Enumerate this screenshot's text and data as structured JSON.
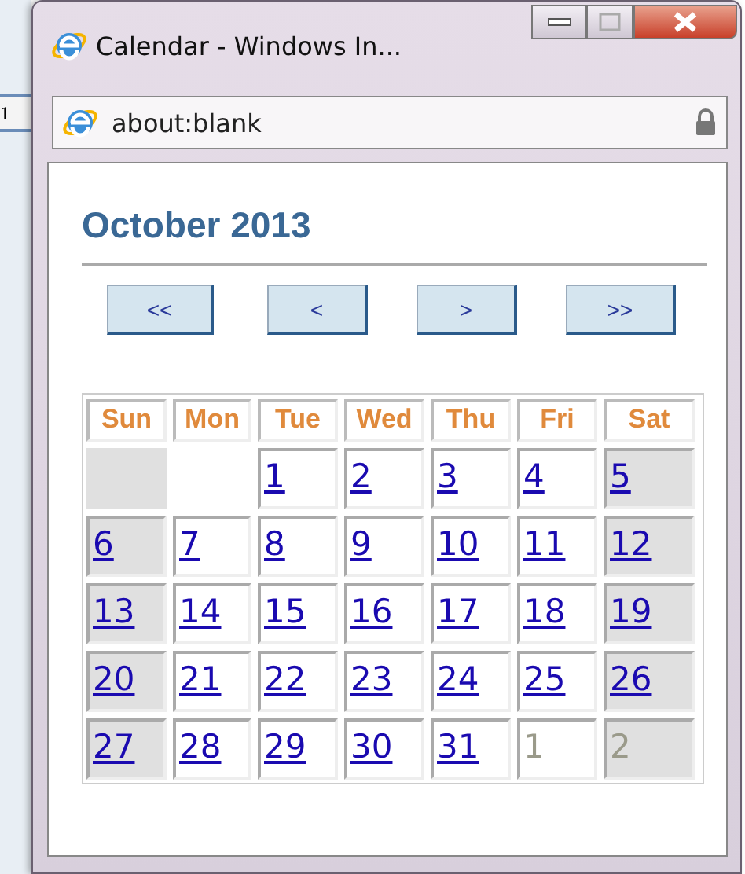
{
  "background_page": {
    "cell_text": "1"
  },
  "window": {
    "title": "Calendar - Windows In...",
    "address": "about:blank"
  },
  "calendar": {
    "title": "October 2013",
    "nav_buttons": [
      "<<",
      "<",
      ">",
      ">>"
    ],
    "weekdays": [
      "Sun",
      "Mon",
      "Tue",
      "Wed",
      "Thu",
      "Fri",
      "Sat"
    ],
    "weeks": [
      [
        {
          "kind": "empty",
          "shaded": true
        },
        {
          "kind": "empty"
        },
        {
          "kind": "day",
          "text": "1",
          "shaded": false
        },
        {
          "kind": "day",
          "text": "2",
          "shaded": false
        },
        {
          "kind": "day",
          "text": "3",
          "shaded": false
        },
        {
          "kind": "day",
          "text": "4",
          "shaded": false
        },
        {
          "kind": "day",
          "text": "5",
          "shaded": true
        }
      ],
      [
        {
          "kind": "day",
          "text": "6",
          "shaded": true
        },
        {
          "kind": "day",
          "text": "7",
          "shaded": false
        },
        {
          "kind": "day",
          "text": "8",
          "shaded": false
        },
        {
          "kind": "day",
          "text": "9",
          "shaded": false
        },
        {
          "kind": "day",
          "text": "10",
          "shaded": false
        },
        {
          "kind": "day",
          "text": "11",
          "shaded": false
        },
        {
          "kind": "day",
          "text": "12",
          "shaded": true
        }
      ],
      [
        {
          "kind": "day",
          "text": "13",
          "shaded": true
        },
        {
          "kind": "day",
          "text": "14",
          "shaded": false
        },
        {
          "kind": "day",
          "text": "15",
          "shaded": false
        },
        {
          "kind": "day",
          "text": "16",
          "shaded": false
        },
        {
          "kind": "day",
          "text": "17",
          "shaded": false
        },
        {
          "kind": "day",
          "text": "18",
          "shaded": false
        },
        {
          "kind": "day",
          "text": "19",
          "shaded": true
        }
      ],
      [
        {
          "kind": "day",
          "text": "20",
          "shaded": true
        },
        {
          "kind": "day",
          "text": "21",
          "shaded": false
        },
        {
          "kind": "day",
          "text": "22",
          "shaded": false
        },
        {
          "kind": "day",
          "text": "23",
          "shaded": false
        },
        {
          "kind": "day",
          "text": "24",
          "shaded": false
        },
        {
          "kind": "day",
          "text": "25",
          "shaded": false
        },
        {
          "kind": "day",
          "text": "26",
          "shaded": true
        }
      ],
      [
        {
          "kind": "day",
          "text": "27",
          "shaded": true
        },
        {
          "kind": "day",
          "text": "28",
          "shaded": false
        },
        {
          "kind": "day",
          "text": "29",
          "shaded": false
        },
        {
          "kind": "day",
          "text": "30",
          "shaded": false
        },
        {
          "kind": "day",
          "text": "31",
          "shaded": false
        },
        {
          "kind": "other",
          "text": "1",
          "shaded": false
        },
        {
          "kind": "other",
          "text": "2",
          "shaded": true
        }
      ]
    ]
  }
}
